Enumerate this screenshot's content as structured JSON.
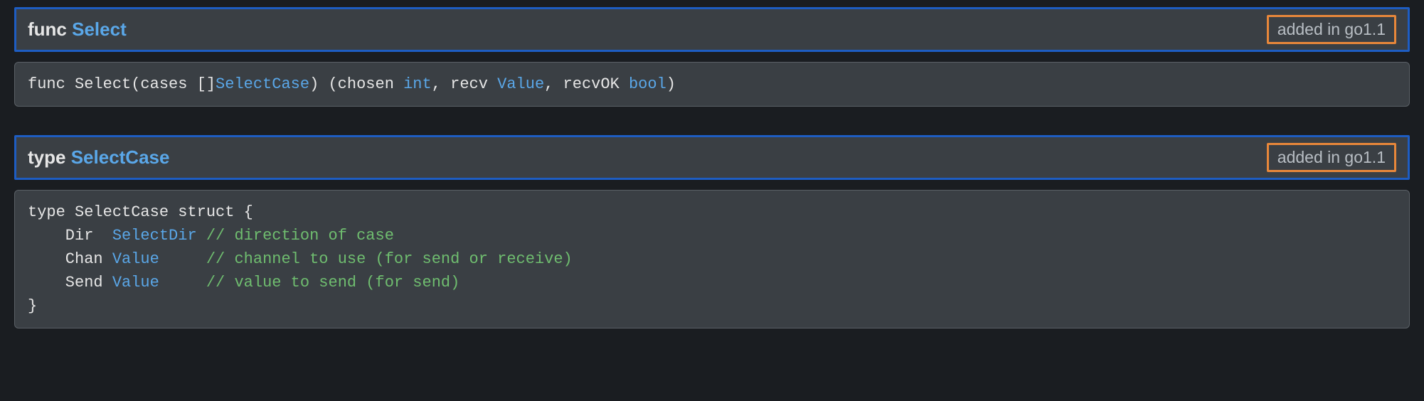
{
  "sections": [
    {
      "header": {
        "kw": "func",
        "name": "Select",
        "badge": "added in go1.1"
      },
      "sig": {
        "t0": "func Select(cases []",
        "l0": "SelectCase",
        "t1": ") (chosen ",
        "l1": "int",
        "t2": ", recv ",
        "l2": "Value",
        "t3": ", recvOK ",
        "l3": "bool",
        "t4": ")"
      }
    },
    {
      "header": {
        "kw": "type",
        "name": "SelectCase",
        "badge": "added in go1.1"
      },
      "struct": {
        "open": "type SelectCase struct {",
        "f0_name": "    Dir  ",
        "f0_type": "SelectDir",
        "f0_pad": " ",
        "f0_comment": "// direction of case",
        "f1_name": "    Chan ",
        "f1_type": "Value",
        "f1_pad": "     ",
        "f1_comment": "// channel to use (for send or receive)",
        "f2_name": "    Send ",
        "f2_type": "Value",
        "f2_pad": "     ",
        "f2_comment": "// value to send (for send)",
        "close": "}"
      }
    }
  ]
}
